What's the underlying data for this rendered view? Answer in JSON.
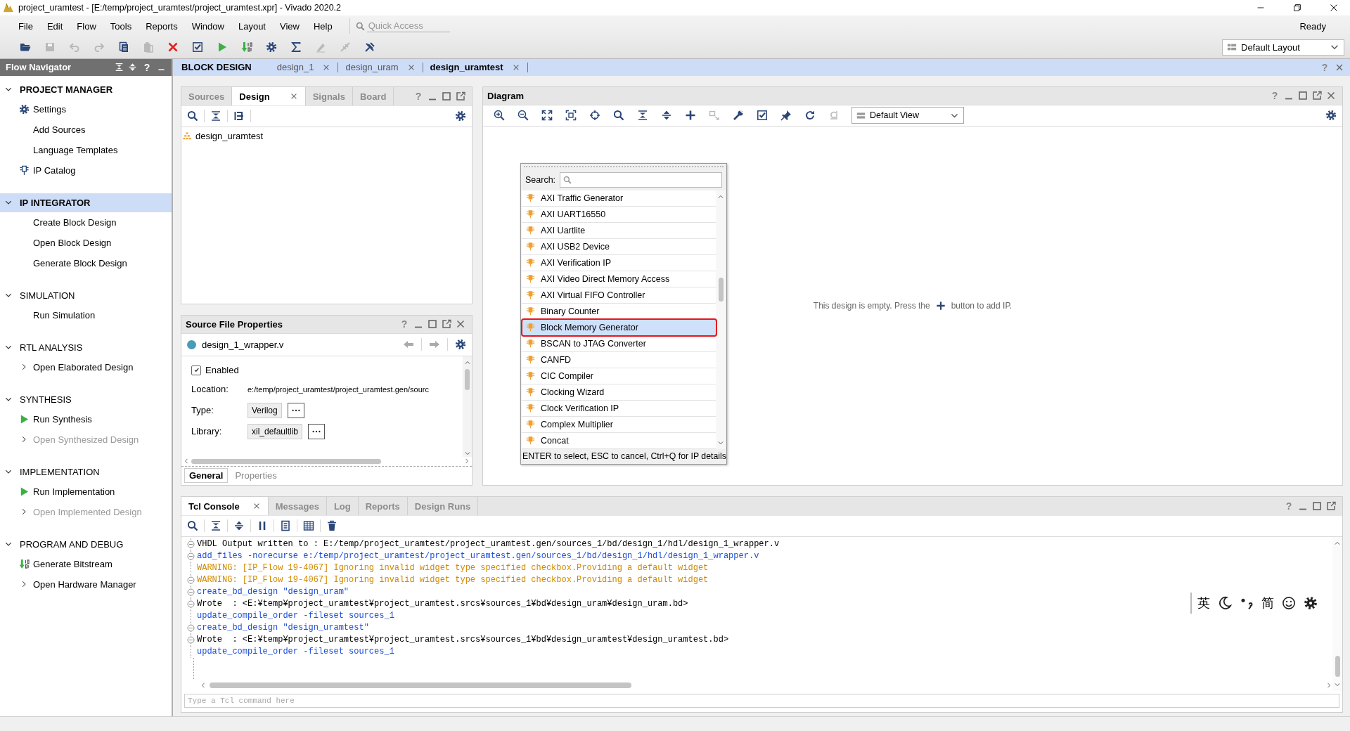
{
  "window": {
    "title": "project_uramtest - [E:/temp/project_uramtest/project_uramtest.xpr] - Vivado 2020.2"
  },
  "menu": [
    "File",
    "Edit",
    "Flow",
    "Tools",
    "Reports",
    "Window",
    "Layout",
    "View",
    "Help"
  ],
  "quick_access": {
    "placeholder": "Quick Access"
  },
  "status": "Ready",
  "layout_selector": {
    "value": "Default Layout"
  },
  "toolbar": [
    {
      "kind": "open",
      "disabled": false
    },
    {
      "kind": "save",
      "disabled": true
    },
    {
      "kind": "undo",
      "disabled": true
    },
    {
      "kind": "redo",
      "disabled": true
    },
    {
      "kind": "copy",
      "disabled": false
    },
    {
      "kind": "paste",
      "disabled": true
    },
    {
      "kind": "delete",
      "disabled": false
    },
    {
      "kind": "check",
      "disabled": false
    },
    {
      "kind": "run",
      "disabled": false
    },
    {
      "kind": "bitstream",
      "disabled": false
    },
    {
      "kind": "settings",
      "disabled": false
    },
    {
      "kind": "sigma",
      "disabled": false
    },
    {
      "kind": "erase",
      "disabled": true
    },
    {
      "kind": "probe",
      "disabled": true
    },
    {
      "kind": "tool",
      "disabled": false
    }
  ],
  "flow_navigator": {
    "title": "Flow Navigator",
    "help": "?",
    "sections": [
      {
        "label": "PROJECT MANAGER",
        "expanded": true,
        "selected": false,
        "bold": true,
        "items": [
          {
            "label": "Settings",
            "kind": "settings",
            "disabled": false
          },
          {
            "label": "Add Sources",
            "kind": "plain",
            "disabled": false
          },
          {
            "label": "Language Templates",
            "kind": "plain",
            "disabled": false
          },
          {
            "label": "IP Catalog",
            "kind": "catalog",
            "disabled": false
          }
        ]
      },
      {
        "label": "IP INTEGRATOR",
        "expanded": true,
        "selected": true,
        "bold": true,
        "items": [
          {
            "label": "Create Block Design",
            "kind": "plain",
            "disabled": false
          },
          {
            "label": "Open Block Design",
            "kind": "plain",
            "disabled": false
          },
          {
            "label": "Generate Block Design",
            "kind": "plain",
            "disabled": false
          }
        ]
      },
      {
        "label": "SIMULATION",
        "expanded": true,
        "selected": false,
        "bold": false,
        "items": [
          {
            "label": "Run Simulation",
            "kind": "plain",
            "disabled": false
          }
        ]
      },
      {
        "label": "RTL ANALYSIS",
        "expanded": true,
        "selected": false,
        "bold": false,
        "items": [
          {
            "label": "Open Elaborated Design",
            "kind": "expandable",
            "disabled": false
          }
        ]
      },
      {
        "label": "SYNTHESIS",
        "expanded": true,
        "selected": false,
        "bold": false,
        "items": [
          {
            "label": "Run Synthesis",
            "kind": "run",
            "disabled": false
          },
          {
            "label": "Open Synthesized Design",
            "kind": "expandable",
            "disabled": true
          }
        ]
      },
      {
        "label": "IMPLEMENTATION",
        "expanded": true,
        "selected": false,
        "bold": false,
        "items": [
          {
            "label": "Run Implementation",
            "kind": "run",
            "disabled": false
          },
          {
            "label": "Open Implemented Design",
            "kind": "expandable",
            "disabled": true
          }
        ]
      },
      {
        "label": "PROGRAM AND DEBUG",
        "expanded": true,
        "selected": false,
        "bold": false,
        "items": [
          {
            "label": "Generate Bitstream",
            "kind": "bitstream",
            "disabled": false
          },
          {
            "label": "Open Hardware Manager",
            "kind": "expandable",
            "disabled": false
          }
        ]
      }
    ]
  },
  "doc_tabs": {
    "title": "BLOCK DESIGN",
    "help": "?",
    "tabs": [
      {
        "label": "design_1",
        "selected": false
      },
      {
        "label": "design_uram",
        "selected": false
      },
      {
        "label": "design_uramtest",
        "selected": true
      }
    ]
  },
  "sources_panel": {
    "help": "?",
    "tabs": [
      {
        "label": "Sources",
        "selected": false,
        "closable": false
      },
      {
        "label": "Design",
        "selected": true,
        "closable": true
      },
      {
        "label": "Signals",
        "selected": false,
        "closable": false
      },
      {
        "label": "Board",
        "selected": false,
        "closable": false
      }
    ],
    "tree": [
      {
        "label": "design_uramtest"
      }
    ]
  },
  "properties_panel": {
    "title": "Source File Properties",
    "help": "?",
    "file": {
      "name": "design_1_wrapper.v",
      "color": "#4a9bb8"
    },
    "enabled": {
      "label": "Enabled",
      "checked": true
    },
    "fields": [
      {
        "label": "Location:",
        "value": "e:/temp/project_uramtest/project_uramtest.gen/sourc",
        "kind": "text"
      },
      {
        "label": "Type:",
        "value": "Verilog",
        "kind": "picker"
      },
      {
        "label": "Library:",
        "value": "xil_defaultlib",
        "kind": "picker"
      }
    ],
    "tabs": [
      {
        "label": "General",
        "selected": true
      },
      {
        "label": "Properties",
        "selected": false
      }
    ]
  },
  "diagram": {
    "title": "Diagram",
    "help": "?",
    "view_selector": {
      "value": "Default View"
    },
    "toolbar": [
      {
        "kind": "zoomin",
        "disabled": false
      },
      {
        "kind": "zoomout",
        "disabled": false
      },
      {
        "kind": "fit",
        "disabled": false
      },
      {
        "kind": "fitsel",
        "disabled": false
      },
      {
        "kind": "target",
        "disabled": false
      },
      {
        "kind": "search",
        "disabled": false
      },
      {
        "kind": "collapse",
        "disabled": false
      },
      {
        "kind": "expand",
        "disabled": false
      },
      {
        "kind": "plus",
        "disabled": false
      },
      {
        "kind": "connect",
        "disabled": true
      },
      {
        "kind": "wrench",
        "disabled": false
      },
      {
        "kind": "check",
        "disabled": false
      },
      {
        "kind": "pin",
        "disabled": false
      },
      {
        "kind": "refresh",
        "disabled": false
      },
      {
        "kind": "regen",
        "disabled": true
      }
    ],
    "empty_message": {
      "before": "This design is empty. Press the",
      "after": "button to add IP."
    },
    "ip_popup": {
      "search_label": "Search:",
      "footer": "ENTER to select, ESC to cancel, Ctrl+Q for IP details",
      "items": [
        {
          "label": "AXI Traffic Generator",
          "selected": false,
          "marked": false
        },
        {
          "label": "AXI UART16550",
          "selected": false,
          "marked": false
        },
        {
          "label": "AXI Uartlite",
          "selected": false,
          "marked": false
        },
        {
          "label": "AXI USB2 Device",
          "selected": false,
          "marked": false
        },
        {
          "label": "AXI Verification IP",
          "selected": false,
          "marked": false
        },
        {
          "label": "AXI Video Direct Memory Access",
          "selected": false,
          "marked": false
        },
        {
          "label": "AXI Virtual FIFO Controller",
          "selected": false,
          "marked": false
        },
        {
          "label": "Binary Counter",
          "selected": false,
          "marked": false
        },
        {
          "label": "Block Memory Generator",
          "selected": true,
          "marked": true
        },
        {
          "label": "BSCAN to JTAG Converter",
          "selected": false,
          "marked": false
        },
        {
          "label": "CANFD",
          "selected": false,
          "marked": false
        },
        {
          "label": "CIC Compiler",
          "selected": false,
          "marked": false
        },
        {
          "label": "Clocking Wizard",
          "selected": false,
          "marked": false
        },
        {
          "label": "Clock Verification IP",
          "selected": false,
          "marked": false
        },
        {
          "label": "Complex Multiplier",
          "selected": false,
          "marked": false
        },
        {
          "label": "Concat",
          "selected": false,
          "marked": false
        }
      ]
    }
  },
  "console": {
    "help": "?",
    "tabs": [
      {
        "label": "Tcl Console",
        "selected": true,
        "closable": true
      },
      {
        "label": "Messages",
        "selected": false,
        "closable": false
      },
      {
        "label": "Log",
        "selected": false,
        "closable": false
      },
      {
        "label": "Reports",
        "selected": false,
        "closable": false
      },
      {
        "label": "Design Runs",
        "selected": false,
        "closable": false
      }
    ],
    "lines": [
      {
        "text": "VHDL Output written to : E:/temp/project_uramtest/project_uramtest.gen/sources_1/bd/design_1/hdl/design_1_wrapper.v",
        "kind": "output",
        "foldable": true
      },
      {
        "text": "add_files -norecurse e:/temp/project_uramtest/project_uramtest.gen/sources_1/bd/design_1/hdl/design_1_wrapper.v",
        "kind": "command",
        "foldable": true
      },
      {
        "text": "WARNING: [IP_Flow 19-4067] Ignoring invalid widget type specified checkbox.Providing a default widget",
        "kind": "warning",
        "foldable": false
      },
      {
        "text": "WARNING: [IP_Flow 19-4067] Ignoring invalid widget type specified checkbox.Providing a default widget",
        "kind": "warning",
        "foldable": true
      },
      {
        "text": "create_bd_design \"design_uram\"",
        "kind": "command",
        "foldable": true
      },
      {
        "text": "Wrote  : <E:¥temp¥project_uramtest¥project_uramtest.srcs¥sources_1¥bd¥design_uram¥design_uram.bd>",
        "kind": "output",
        "foldable": true
      },
      {
        "text": "update_compile_order -fileset sources_1",
        "kind": "command",
        "foldable": false
      },
      {
        "text": "create_bd_design \"design_uramtest\"",
        "kind": "command",
        "foldable": true
      },
      {
        "text": "Wrote  : <E:¥temp¥project_uramtest¥project_uramtest.srcs¥sources_1¥bd¥design_uramtest¥design_uramtest.bd>",
        "kind": "output",
        "foldable": true
      },
      {
        "text": "update_compile_order -fileset sources_1",
        "kind": "command",
        "foldable": false
      }
    ],
    "input": {
      "placeholder": "Type a Tcl command here"
    }
  },
  "ime_bar": {
    "items": [
      {
        "kind": "text",
        "label": "英"
      },
      {
        "kind": "moon"
      },
      {
        "kind": "punct"
      },
      {
        "kind": "text",
        "label": "简"
      },
      {
        "kind": "smiley"
      },
      {
        "kind": "gear"
      }
    ]
  }
}
